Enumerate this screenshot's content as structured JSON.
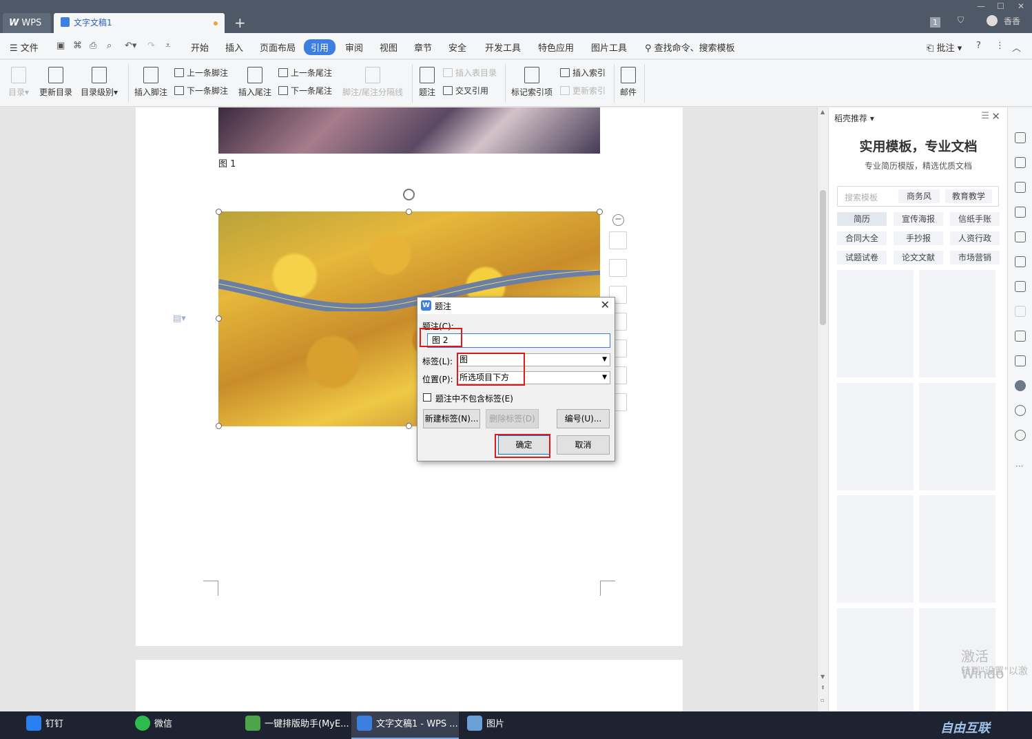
{
  "titlebar": {
    "wps_tab": "WPS",
    "doc_tab": "文字文稿1",
    "user_name": "香香",
    "page_count_badge": "1"
  },
  "menu": {
    "file": "文件",
    "items": [
      "开始",
      "插入",
      "页面布局",
      "引用",
      "审阅",
      "视图",
      "章节",
      "安全",
      "开发工具",
      "特色应用",
      "图片工具"
    ],
    "active": "引用",
    "search": "查找命令、搜索模板",
    "comment": "批注"
  },
  "ribbon": {
    "toc": "目录",
    "update_toc": "更新目录",
    "toc_level": "目录级别",
    "insert_footnote": "插入脚注",
    "prev_footnote": "上一条脚注",
    "next_footnote": "下一条脚注",
    "insert_endnote": "插入尾注",
    "prev_endnote": "上一条尾注",
    "next_endnote": "下一条尾注",
    "separator": "脚注/尾注分隔线",
    "caption": "题注",
    "insert_table_toc": "插入表目录",
    "cross_ref": "交叉引用",
    "mark_index": "标记索引项",
    "insert_index": "插入索引",
    "update_index": "更新索引",
    "mail": "邮件"
  },
  "document": {
    "caption1": "图 1"
  },
  "dialog": {
    "title": "题注",
    "caption_label": "题注(C):",
    "caption_value": "图 2",
    "label_label": "标签(L):",
    "label_value": "图",
    "position_label": "位置(P):",
    "position_value": "所选项目下方",
    "exclude_label": "题注中不包含标签(E)",
    "exclude_checked": false,
    "new_label": "新建标签(N)...",
    "delete_label": "删除标签(D)",
    "numbering": "编号(U)...",
    "ok": "确定",
    "cancel": "取消"
  },
  "right_pane": {
    "header": "稻壳推荐",
    "title": "实用模板，专业文档",
    "subtitle": "专业简历模版，精选优质文档",
    "search_placeholder": "搜索模板",
    "search_tags": [
      "商务风",
      "教育教学"
    ],
    "categories": [
      "简历",
      "宣传海报",
      "信纸手账",
      "合同大全",
      "手抄报",
      "人资行政",
      "试题试卷",
      "论文文献",
      "市场营销"
    ],
    "selected_category": "简历"
  },
  "taskbar": {
    "items": [
      "钉钉",
      "微信",
      "一键排版助手(MyE...",
      "文字文稿1 - WPS ...",
      "图片"
    ],
    "active": "文字文稿1 - WPS ..."
  },
  "watermark": {
    "activate_line1": "激活 Windo",
    "activate_line2": "转到\"设置\"以激",
    "site": "自由互联"
  },
  "colors": {
    "titlebar": "#4e5867",
    "accent": "#3d7fe0",
    "highlight_box": "#e01818",
    "taskbar": "#1d2330"
  }
}
